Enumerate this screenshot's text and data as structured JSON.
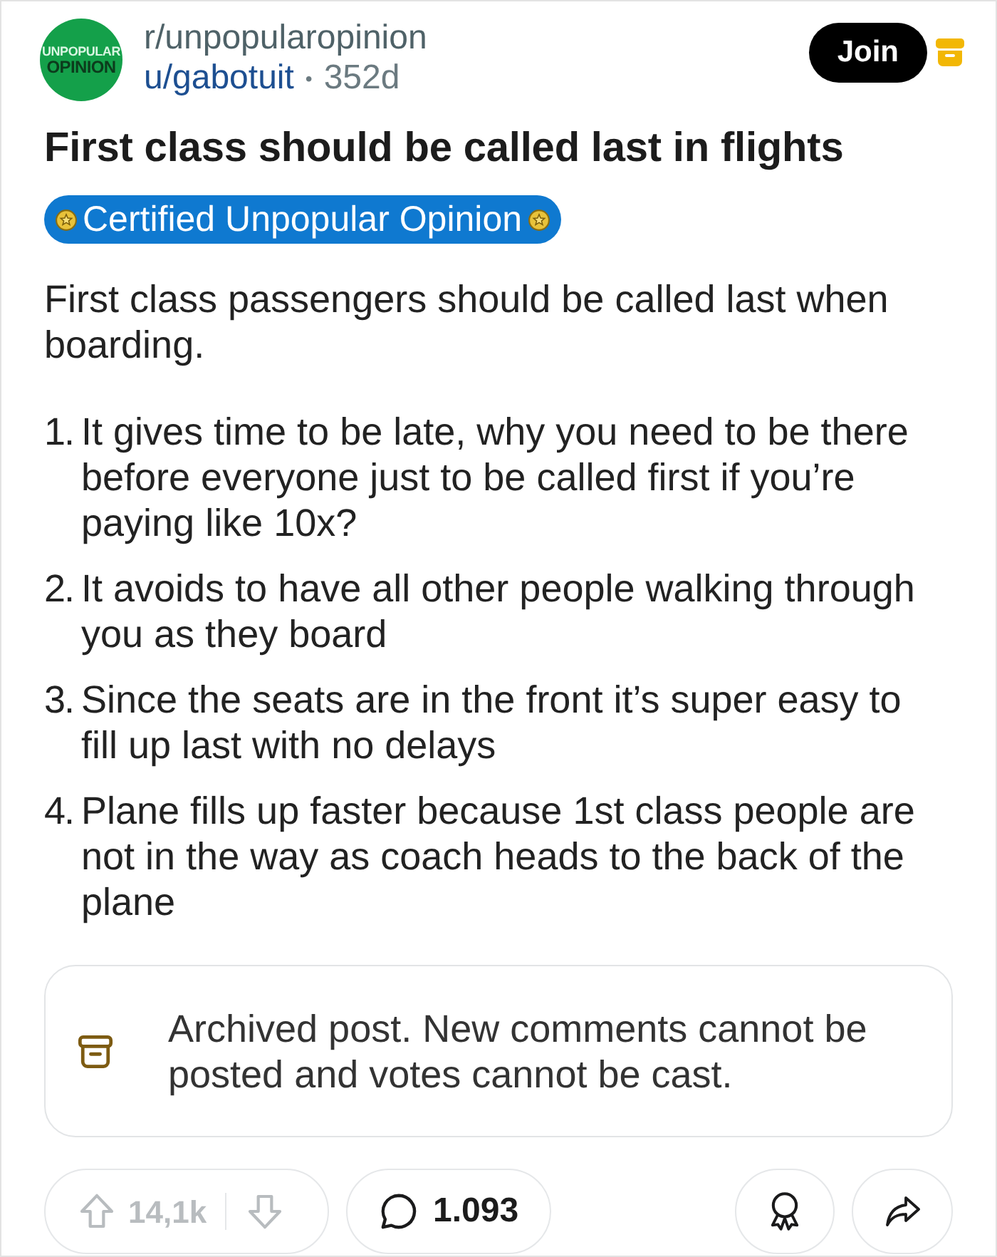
{
  "post": {
    "avatar": {
      "lines": [
        "UNPOPULAR",
        "OPINION"
      ]
    },
    "subreddit": "r/unpopularopinion",
    "author": "u/gabotuit",
    "separator": "•",
    "age": "352d",
    "join_button": "Join",
    "title": "First class should be called last in flights",
    "flair": "Certified Unpopular Opinion",
    "body": {
      "intro": "First class passengers should be called last when boarding.",
      "list": [
        {
          "number": "1.",
          "text": "It gives time to be late, why you need to be there before everyone just to be called first if you’re paying like 10x?"
        },
        {
          "number": "2.",
          "text": "It avoids to have all other people walking through you as they board"
        },
        {
          "number": "3.",
          "text": "Since the seats are in the front it’s super easy to fill up last with no delays"
        },
        {
          "number": "4.",
          "text": "Plane fills up faster because 1st class people are not in the way as coach heads to the back of the plane"
        }
      ]
    }
  },
  "archived_notice": {
    "text": "Archived post. New comments cannot be posted and votes cannot be cast."
  },
  "actions": {
    "score": "14,1k",
    "voting_disabled": true,
    "comments": "1.093"
  }
}
